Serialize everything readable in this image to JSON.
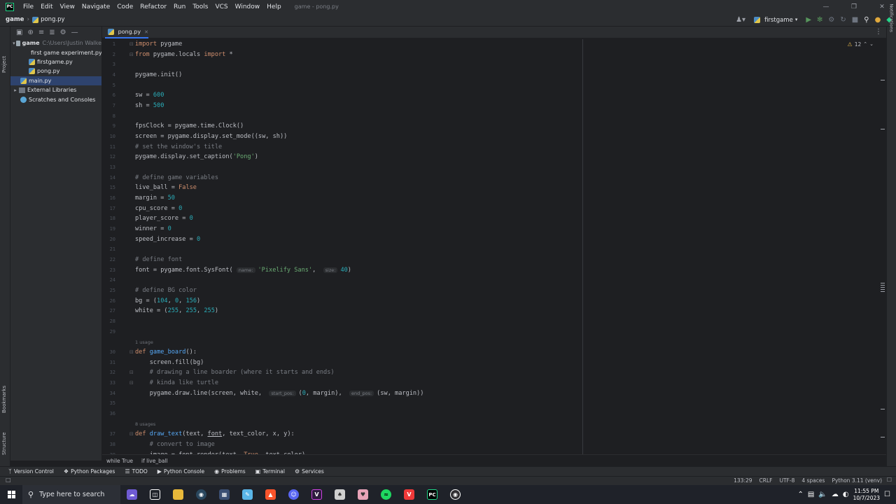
{
  "menubar": {
    "items": [
      "File",
      "Edit",
      "View",
      "Navigate",
      "Code",
      "Refactor",
      "Run",
      "Tools",
      "VCS",
      "Window",
      "Help"
    ],
    "window_title": "game - pong.py",
    "logo": "PC"
  },
  "navbar": {
    "project": "game",
    "file": "pong.py",
    "run_config": "firstgame"
  },
  "left_strip": {
    "project_label": "Project",
    "bookmarks_label": "Bookmarks",
    "structure_label": "Structure"
  },
  "right_strip": {
    "notifications_label": "Notifications"
  },
  "project_tree": {
    "root_name": "game",
    "root_path": "C:\\Users\\Justin Walke",
    "files": [
      "first game experiment.py",
      "firstgame.py",
      "pong.py"
    ],
    "main": "main.py",
    "external": "External Libraries",
    "scratches": "Scratches and Consoles"
  },
  "tab": {
    "label": "pong.py"
  },
  "inspection": {
    "count": "12"
  },
  "editor": {
    "usage_1": "1 usage",
    "usage_2": "8 usages",
    "hints": {
      "name": "name:",
      "size": "size:",
      "start_pos": "start_pos:",
      "end_pos": "end_pos:"
    },
    "line_numbers": [
      "1",
      "2",
      "3",
      "4",
      "5",
      "6",
      "7",
      "8",
      "9",
      "10",
      "11",
      "12",
      "13",
      "14",
      "15",
      "16",
      "17",
      "18",
      "19",
      "20",
      "21",
      "22",
      "23",
      "24",
      "25",
      "26",
      "27",
      "28",
      "29",
      "30",
      "31",
      "32",
      "33",
      "34",
      "35",
      "36",
      "37",
      "38",
      "39"
    ]
  },
  "code_crumbs": [
    "while True",
    "if live_ball"
  ],
  "toolwindows": [
    "Version Control",
    "Python Packages",
    "TODO",
    "Python Console",
    "Problems",
    "Terminal",
    "Services"
  ],
  "status": {
    "position": "133:29",
    "line_sep": "CRLF",
    "encoding": "UTF-8",
    "indent": "4 spaces",
    "interpreter": "Python 3.11 (venv)"
  },
  "taskbar": {
    "search_placeholder": "Type here to search",
    "time": "11:55 PM",
    "date": "10/7/2023"
  },
  "icons": {
    "search": "search-icon",
    "gear": "gear-icon",
    "run": "run-icon",
    "debug": "debug-icon",
    "collapse": "collapse-icon",
    "warning": "warning-icon"
  },
  "colors": {
    "accent": "#3574f0",
    "keyword": "#cf8e6d",
    "number": "#2aacb8",
    "string": "#6aab73",
    "comment": "#7a7e85",
    "function": "#56a8f5"
  }
}
